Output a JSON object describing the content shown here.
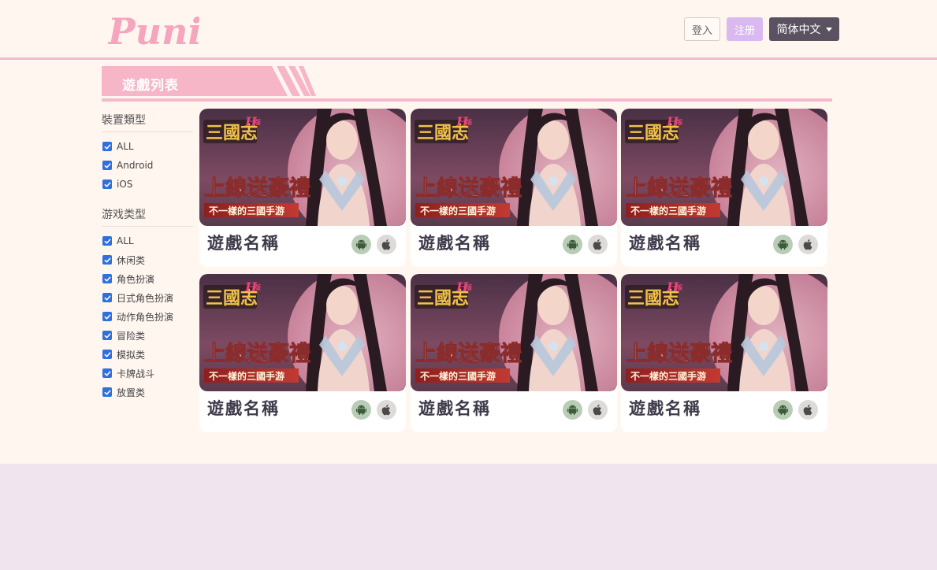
{
  "header": {
    "logo_text": "Puni",
    "login_label": "登入",
    "register_label": "注册",
    "language_label": "简体中文"
  },
  "section": {
    "title": "遊戲列表"
  },
  "sidebar": {
    "device_group": {
      "title": "裝置類型",
      "items": [
        "ALL",
        "Android",
        "iOS"
      ]
    },
    "genre_group": {
      "title": "游戏类型",
      "items": [
        "ALL",
        "休闲类",
        "角色扮演",
        "日式角色扮演",
        "动作角色扮演",
        "冒险类",
        "模拟类",
        "卡牌战斗",
        "放置类"
      ]
    }
  },
  "games": [
    {
      "name": "遊戲名稱",
      "banner_logo": "三國志 H版",
      "banner_headline": "上線送豪禮",
      "banner_sub": "不一樣的三國手游"
    },
    {
      "name": "遊戲名稱",
      "banner_logo": "三國志 H版",
      "banner_headline": "上線送豪禮",
      "banner_sub": "不一樣的三國手游"
    },
    {
      "name": "遊戲名稱",
      "banner_logo": "三國志 H版",
      "banner_headline": "上線送豪禮",
      "banner_sub": "不一樣的三國手游"
    },
    {
      "name": "遊戲名稱",
      "banner_logo": "三國志 H版",
      "banner_headline": "上線送豪禮",
      "banner_sub": "不一樣的三國手游"
    },
    {
      "name": "遊戲名稱",
      "banner_logo": "三國志 H版",
      "banner_headline": "上線送豪禮",
      "banner_sub": "不一樣的三國手游"
    },
    {
      "name": "遊戲名稱",
      "banner_logo": "三國志 H版",
      "banner_headline": "上線送豪禮",
      "banner_sub": "不一樣的三國手游"
    }
  ],
  "icons": {
    "android": "android-icon",
    "ios": "apple-icon",
    "checkbox": "checkbox-checked-icon"
  },
  "colors": {
    "accent_pink": "#f4b9ca",
    "register_purple": "#d9b9ef",
    "language_dark": "#5a5260",
    "checkbox_blue": "#2f6fde",
    "page_bg": "#fff6f0",
    "footer_bg": "#f0e4ee"
  }
}
